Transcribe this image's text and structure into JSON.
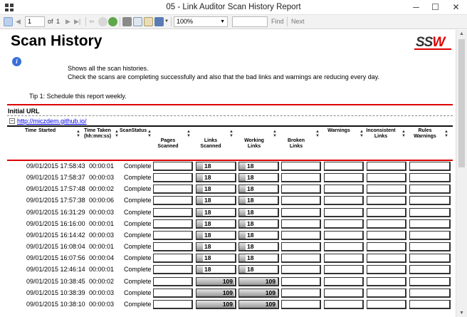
{
  "window": {
    "title": "05 - Link Auditor Scan History Report",
    "min": "─",
    "max": "☐",
    "close": "✕"
  },
  "toolbar": {
    "page_value": "1",
    "page_of": "of",
    "page_total": "1",
    "zoom": "100%",
    "find_label": "Find",
    "next_label": "Next"
  },
  "report": {
    "title": "Scan History",
    "logo": {
      "ss": "SS",
      "w": "W"
    },
    "description_line1": "Shows all the scan histories.",
    "description_line2": "Check the scans are completing successfully and also that the bad links and warnings are reducing every day.",
    "tip": "Tip 1: Schedule this report weekly.",
    "group_label": "Initial URL",
    "url": "http://miczdem.github.io/",
    "expander": "−",
    "columns": {
      "time": "Time",
      "started": "Started",
      "time_taken": "Time Taken (hh:mm:ss)",
      "scan_status": "ScanStatus",
      "pages_scanned": "Pages Scanned",
      "links_scanned": "Links Scanned",
      "working_links": "Working Links",
      "broken_links": "Broken Links",
      "warnings": "Warnings",
      "inconsistent_links": "Inconsistent Links",
      "rules_warnings": "Rules Warnings"
    }
  },
  "rows": [
    {
      "started": "09/01/2015 17:58:43",
      "taken": "00:00:01",
      "status": "Complete",
      "links": "18",
      "working": "18",
      "links_frac": 0.17,
      "working_frac": 0.17
    },
    {
      "started": "09/01/2015 17:58:37",
      "taken": "00:00:03",
      "status": "Complete",
      "links": "18",
      "working": "18",
      "links_frac": 0.17,
      "working_frac": 0.17
    },
    {
      "started": "09/01/2015 17:57:48",
      "taken": "00:00:02",
      "status": "Complete",
      "links": "18",
      "working": "18",
      "links_frac": 0.17,
      "working_frac": 0.17
    },
    {
      "started": "09/01/2015 17:57:38",
      "taken": "00:00:06",
      "status": "Complete",
      "links": "18",
      "working": "18",
      "links_frac": 0.17,
      "working_frac": 0.17
    },
    {
      "started": "09/01/2015 16:31:29",
      "taken": "00:00:03",
      "status": "Complete",
      "links": "18",
      "working": "18",
      "links_frac": 0.17,
      "working_frac": 0.17
    },
    {
      "started": "09/01/2015 16:16:00",
      "taken": "00:00:01",
      "status": "Complete",
      "links": "18",
      "working": "18",
      "links_frac": 0.17,
      "working_frac": 0.17
    },
    {
      "started": "09/01/2015 16:14:42",
      "taken": "00:00:03",
      "status": "Complete",
      "links": "18",
      "working": "18",
      "links_frac": 0.17,
      "working_frac": 0.17
    },
    {
      "started": "09/01/2015 16:08:04",
      "taken": "00:00:01",
      "status": "Complete",
      "links": "18",
      "working": "18",
      "links_frac": 0.17,
      "working_frac": 0.17
    },
    {
      "started": "09/01/2015 16:07:56",
      "taken": "00:00:04",
      "status": "Complete",
      "links": "18",
      "working": "18",
      "links_frac": 0.17,
      "working_frac": 0.17
    },
    {
      "started": "09/01/2015 12:46:14",
      "taken": "00:00:01",
      "status": "Complete",
      "links": "18",
      "working": "18",
      "links_frac": 0.17,
      "working_frac": 0.17
    },
    {
      "started": "09/01/2015 10:38:45",
      "taken": "00:00:02",
      "status": "Complete",
      "links": "109",
      "working": "109",
      "links_frac": 1.0,
      "working_frac": 1.0
    },
    {
      "started": "09/01/2015 10:38:39",
      "taken": "00:00:03",
      "status": "Complete",
      "links": "109",
      "working": "109",
      "links_frac": 1.0,
      "working_frac": 1.0
    },
    {
      "started": "09/01/2015 10:38:10",
      "taken": "00:00:03",
      "status": "Complete",
      "links": "109",
      "working": "109",
      "links_frac": 1.0,
      "working_frac": 1.0
    }
  ]
}
